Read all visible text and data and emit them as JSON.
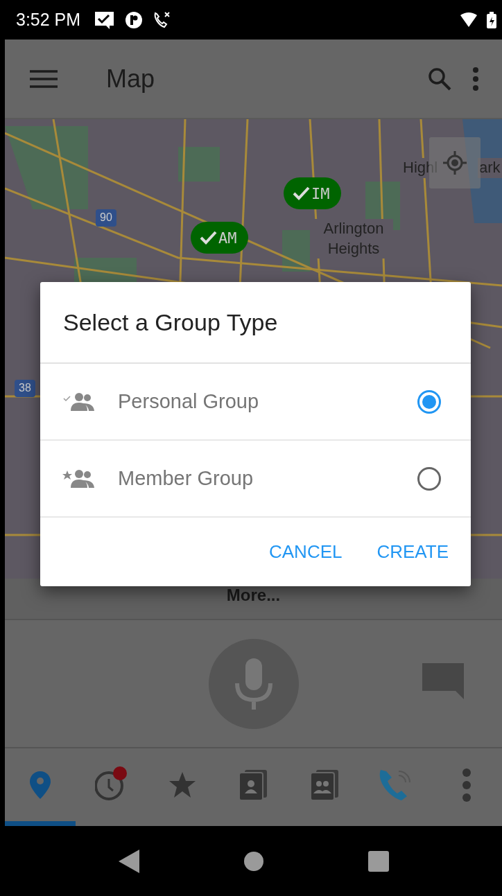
{
  "status_bar": {
    "time": "3:52 PM"
  },
  "app_bar": {
    "title": "Map"
  },
  "map": {
    "labels": [
      {
        "text": "Highl",
        "kind": "place"
      },
      {
        "text": "ark",
        "kind": "place"
      },
      {
        "text": "Arlington Heights",
        "kind": "place"
      },
      {
        "text": "90",
        "kind": "shield"
      },
      {
        "text": "38",
        "kind": "shield"
      }
    ],
    "markers": [
      {
        "label": "IM"
      },
      {
        "label": "AM"
      }
    ]
  },
  "more_link": "More...",
  "bottom_nav": [
    {
      "kind": "map",
      "selected": true
    },
    {
      "kind": "recent",
      "selected": false,
      "badge": true
    },
    {
      "kind": "favorites",
      "selected": false
    },
    {
      "kind": "contacts",
      "selected": false
    },
    {
      "kind": "groups",
      "selected": false
    },
    {
      "kind": "call",
      "selected": false
    },
    {
      "kind": "more",
      "selected": false
    }
  ],
  "dialog": {
    "title": "Select a Group Type",
    "options": [
      {
        "kind": "personal",
        "label": "Personal Group",
        "selected": true
      },
      {
        "kind": "member",
        "label": "Member Group",
        "selected": false
      }
    ],
    "buttons": [
      "CANCEL",
      "CREATE"
    ]
  }
}
